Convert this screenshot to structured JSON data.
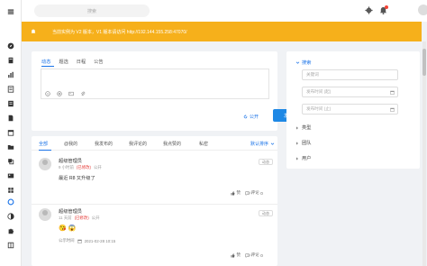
{
  "topbar": {
    "search_placeholder": "搜索",
    "settings_icon": "gear-icon",
    "bell_icon": "bell-icon",
    "avatar": "avatar"
  },
  "notice": {
    "icon": "bell-icon",
    "text": "当前实例为 V2 版本，V1 版本请访问 http://192.144.155.258:47070/"
  },
  "sidebar": {
    "icons": [
      "menu-icon",
      "compass-icon",
      "book-icon",
      "chart-icon",
      "list-icon",
      "report-icon",
      "doc-icon",
      "calendar-icon",
      "folder-icon",
      "layers-icon",
      "image-icon",
      "apps-icon",
      "settings-circle-icon",
      "contrast-icon",
      "puzzle-icon",
      "grid-icon"
    ],
    "active_index": 12
  },
  "composer": {
    "tabs": [
      "动态",
      "题选",
      "日程",
      "公告"
    ],
    "active_tab": 0,
    "text_value": "",
    "tools": [
      "emoji-icon",
      "at-icon",
      "image-icon",
      "attachment-icon"
    ],
    "visibility_label": "公开",
    "publish_label": "发布"
  },
  "feed": {
    "tabs": [
      "全部",
      "@我的",
      "我发布的",
      "我评论的",
      "我点赞的",
      "私密"
    ],
    "active_tab": 0,
    "sort_label": "默认排序",
    "posts": [
      {
        "name": "超级管理员",
        "time": "9 小时前",
        "edited": "(已修改)",
        "visibility": "公开",
        "status": "动态",
        "content": "最近 R8 又升级了",
        "like_label": "赞",
        "comment_label": "评论",
        "comment_count": "0"
      },
      {
        "name": "超级管理员",
        "time": "11 天前",
        "edited": "(已修改)",
        "visibility": "公开",
        "status": "动态",
        "emojis": [
          "😘",
          "😱"
        ],
        "pub_label": "公示时间",
        "pub_time": "2021-02-28 10:15",
        "like_label": "赞",
        "comment_label": "评论",
        "comment_count": "0"
      }
    ]
  },
  "filter": {
    "title": "搜索",
    "keyword_placeholder": "关键词",
    "date_from_placeholder": "发布时间 (起)",
    "date_to_placeholder": "发布时间 (止)",
    "groups": [
      "类型",
      "团队",
      "用户"
    ]
  },
  "colors": {
    "accent": "#1a73e8",
    "notice_bg": "#f6b01b",
    "edited": "#e53935"
  }
}
